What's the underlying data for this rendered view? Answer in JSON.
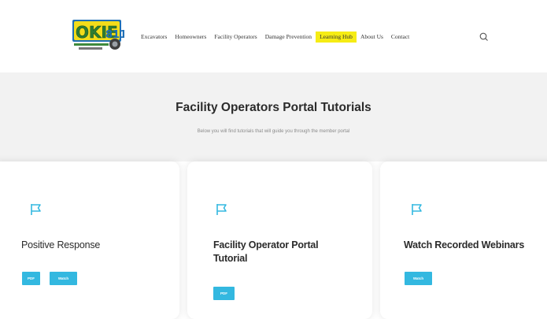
{
  "header": {
    "logo": {
      "name": "OKIE811"
    },
    "nav": [
      {
        "label": "Excavators"
      },
      {
        "label": "Homeowners"
      },
      {
        "label": "Facility Operators"
      },
      {
        "label": "Damage Prevention"
      },
      {
        "label": "Learning Hub",
        "active": true
      },
      {
        "label": "About Us"
      },
      {
        "label": "Contact"
      }
    ],
    "search_icon": "search-icon"
  },
  "hero": {
    "title": "Facility Operators Portal Tutorials",
    "subtitle": "Below you will find tutorials that will guide you through the member portal"
  },
  "cards": [
    {
      "title": "Positive Response",
      "icon": "flag-icon",
      "buttons": [
        "PDF",
        "Watch"
      ]
    },
    {
      "title": "Facility Operator Portal Tutorial",
      "icon": "flag-icon",
      "buttons": [
        "PDF"
      ]
    },
    {
      "title": "Watch Recorded Webinars",
      "icon": "flag-icon",
      "buttons": [
        "Watch"
      ]
    }
  ],
  "colors": {
    "accent": "#33b8e0",
    "highlight": "#f6ec14",
    "hero_bg": "#f2f2f2",
    "logo_yellow": "#f3dc1a",
    "logo_green": "#3f8a3c",
    "logo_blue": "#1f6fb5"
  }
}
